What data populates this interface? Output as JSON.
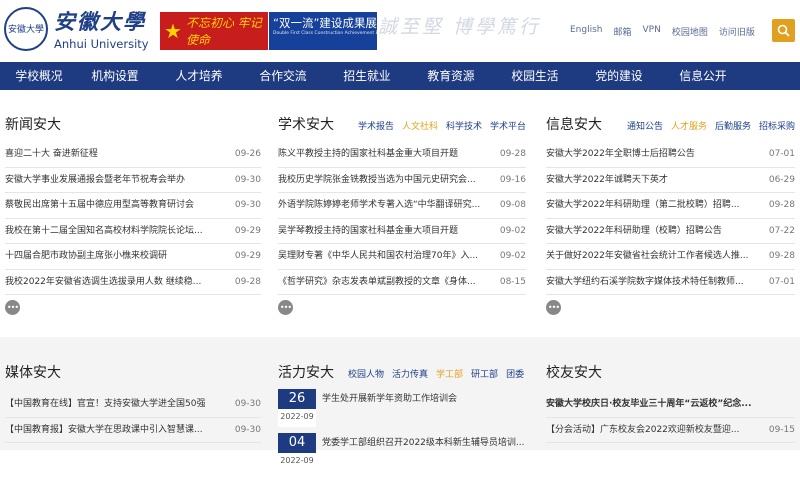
{
  "header": {
    "seal_text": "安徽大學",
    "logo_cn": "安徽大學",
    "logo_en": "Anhui University",
    "banner1_text": "不忘初心 牢记使命",
    "banner2_title": "“双一流”建设成果展",
    "banner2_sub": "Double First Class Construction Achievement Exhibition",
    "motto": "誠⾄堅 博學篤⾏",
    "links": [
      "English",
      "邮箱",
      "VPN",
      "校园地图",
      "访问旧版"
    ]
  },
  "nav": [
    "学校概况",
    "机构设置",
    "人才培养",
    "合作交流",
    "招生就业",
    "教育资源",
    "校园生活",
    "党的建设",
    "信息公开"
  ],
  "news": {
    "title": "新闻安大",
    "items": [
      {
        "text": "喜迎二十大 奋进新征程",
        "date": "09-26"
      },
      {
        "text": "安徽大学事业发展通报会暨老年节祝寿会举办",
        "date": "09-30"
      },
      {
        "text": "蔡敬民出席第十五届中德应用型高等教育研讨会",
        "date": "09-30"
      },
      {
        "text": "我校在第十二届全国知名高校材料学院院长论坛...",
        "date": "09-29"
      },
      {
        "text": "十四届合肥市政协副主席张小樵来校调研",
        "date": "09-29"
      },
      {
        "text": "我校2022年安徽省选调生选拔录用人数 继续稳...",
        "date": "09-28"
      }
    ]
  },
  "academic": {
    "title": "学术安大",
    "tabs": [
      "学术报告",
      "人文社科",
      "科学技术",
      "学术平台"
    ],
    "active_tab": 1,
    "items": [
      {
        "text": "陈义平教授主持的国家社科基金重大项目开题",
        "date": "09-28"
      },
      {
        "text": "我校历史学院张金铣教授当选为中国元史研究会...",
        "date": "09-16"
      },
      {
        "text": "外语学院陈婷婷老师学术专著入选“中华翻译研究...",
        "date": "09-08"
      },
      {
        "text": "吴学琴教授主持的国家社科基金重大项目开题",
        "date": "09-02"
      },
      {
        "text": "吴理财专著《中华人民共和国农村治理70年》入...",
        "date": "09-02"
      },
      {
        "text": "《哲学研究》杂志发表单斌副教授的文章《身体...",
        "date": "08-15"
      }
    ]
  },
  "info": {
    "title": "信息安大",
    "tabs": [
      "通知公告",
      "人才服务",
      "后勤服务",
      "招标采购"
    ],
    "active_tab": 1,
    "items": [
      {
        "text": "安徽大学2022年全职博士后招聘公告",
        "date": "07-01"
      },
      {
        "text": "安徽大学2022年诚聘天下英才",
        "date": "06-29"
      },
      {
        "text": "安徽大学2022年科研助理（第二批校聘）招聘...",
        "date": "09-28"
      },
      {
        "text": "安徽大学2022年科研助理（校聘）招聘公告",
        "date": "07-22"
      },
      {
        "text": "关于做好2022年安徽省社会统计工作者候选人推...",
        "date": "09-28"
      },
      {
        "text": "安徽大学纽约石溪学院数字媒体技术特任制教师...",
        "date": "07-01"
      }
    ]
  },
  "media": {
    "title": "媒体安大",
    "items": [
      {
        "text": "【中国教育在线】官宣！支持安徽大学进全国50强",
        "date": "09-30"
      },
      {
        "text": "【中国教育报】安徽大学在思政课中引入智慧课...",
        "date": "09-30"
      }
    ]
  },
  "huoli": {
    "title": "活力安大",
    "tabs": [
      "校园人物",
      "活力传真",
      "学工部",
      "研工部",
      "团委"
    ],
    "active_tab": 2,
    "items": [
      {
        "day": "26",
        "ym": "2022-09",
        "text": "学生处开展新学年资助工作培训会"
      },
      {
        "day": "04",
        "ym": "2022-09",
        "text": "党委学工部组织召开2022级本科新生辅导员培训..."
      }
    ]
  },
  "alumni": {
    "title": "校友安大",
    "items": [
      {
        "text": "安徽大学校庆日·校友毕业三十周年“云返校”纪念...",
        "date": ""
      },
      {
        "text": "【分会活动】广东校友会2022欢迎新校友暨迎...",
        "date": "09-15"
      }
    ]
  },
  "more_label": "•••",
  "search_icon": "search-icon"
}
